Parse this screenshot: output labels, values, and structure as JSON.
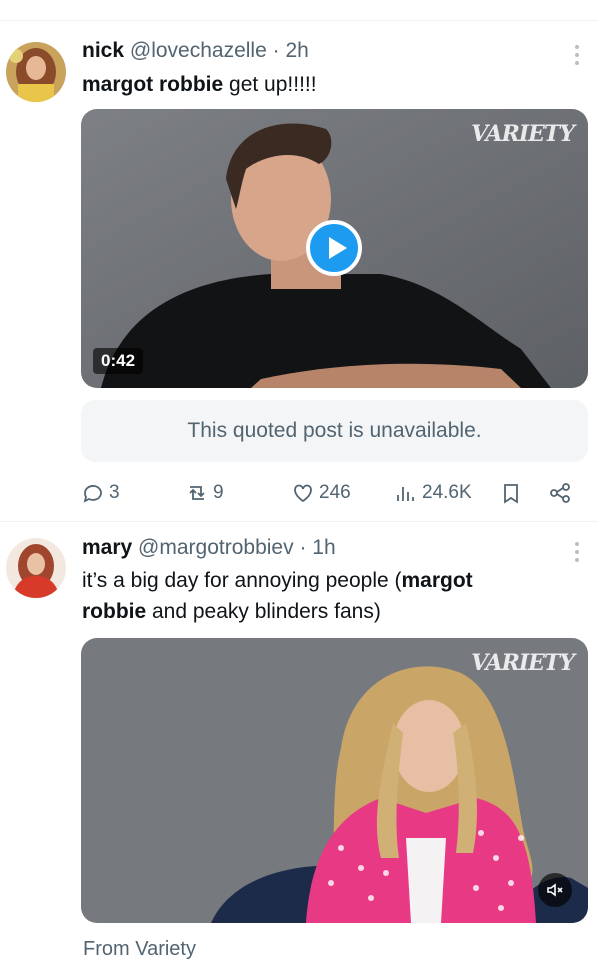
{
  "tweets": [
    {
      "name": "nick",
      "handle": "@lovechazelle",
      "separator": " · ",
      "time": "2h",
      "text": [
        {
          "bold": "margot robbie"
        },
        {
          "plain": " get up!!!!!"
        }
      ],
      "media": {
        "watermark": "VARIETY",
        "duration": "0:42"
      },
      "quoted": "This quoted post is unavailable.",
      "stats": {
        "replies": "3",
        "reposts": "9",
        "likes": "246",
        "views": "24.6K"
      }
    },
    {
      "name": "mary",
      "handle": "@margotrobbiev",
      "separator": " · ",
      "time": "1h",
      "text_line1_plain": "it’s a big day for annoying people (",
      "text_line1_bold": "margot",
      "text_line2_bold": "robbie",
      "text_line2_plain": " and peaky blinders  fans)",
      "media": {
        "watermark": "VARIETY"
      },
      "source": "From Variety"
    }
  ],
  "icons": [
    "more-icon",
    "play-icon",
    "mute-icon",
    "reply-icon",
    "repost-icon",
    "like-icon",
    "views-icon",
    "bookmark-icon",
    "share-icon"
  ],
  "colors": {
    "accent": "#1d9bf0",
    "secondary_text": "#536471",
    "jacket_pink": "#e83a84"
  }
}
